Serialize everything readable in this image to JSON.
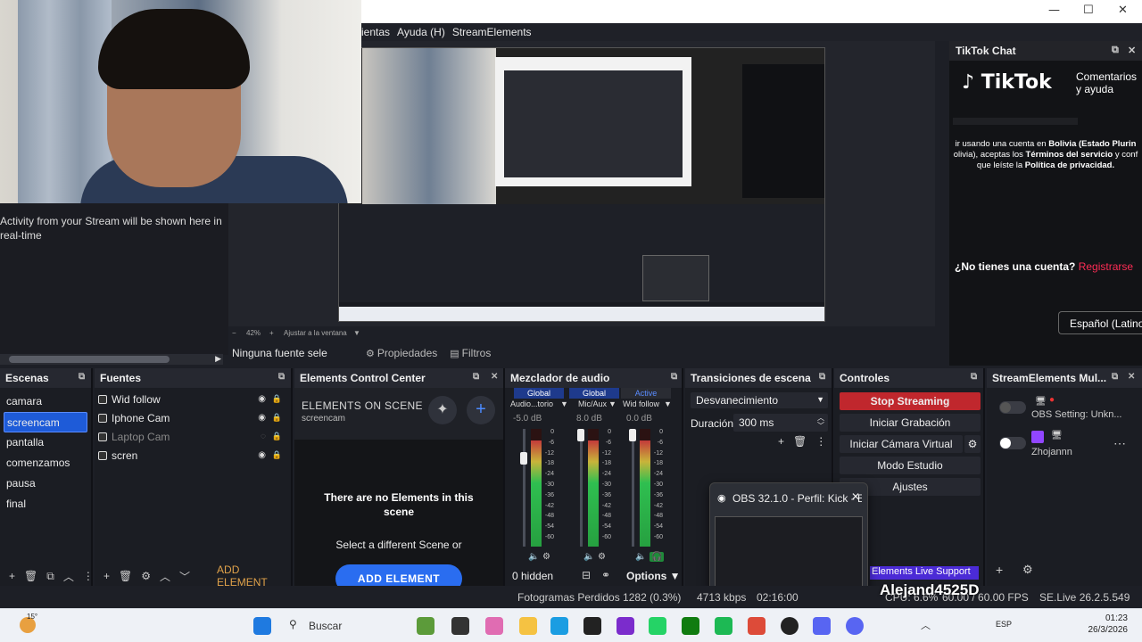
{
  "menu": {
    "items": [
      "ientas",
      "Ayuda (H)",
      "StreamElements"
    ]
  },
  "window_controls": {
    "minimize": "—",
    "maximize": "☐",
    "close": "✕"
  },
  "activity": {
    "text": "Activity from your Stream will be shown here in real-time"
  },
  "preview": {
    "zoom_label": "42%",
    "fit_label": "Ajustar a la ventana"
  },
  "tiktok_chat": {
    "title": "TikTok Chat",
    "logo_text": "TikTok",
    "subtitle_line1": "Comentarios",
    "subtitle_line2": "y ayuda",
    "terms_l1": "ir usando una cuenta en",
    "terms_l1b": "Bolivia (Estado Plurin",
    "terms_l2a": "olivia), aceptas los",
    "terms_l2b": "Términos del servicio",
    "terms_l2c": "y conf",
    "terms_l3a": "que leíste la",
    "terms_l3b": "Política de privacidad.",
    "question": "¿No tienes una cuenta?",
    "signup": "Registrarse",
    "language": "Español (Latino"
  },
  "source_toolbar": {
    "no_source": "Ninguna fuente sele",
    "properties": "Propiedades",
    "filters": "Filtros"
  },
  "scenes": {
    "title": "Escenas",
    "items": [
      "camara",
      "screencam",
      "pantalla",
      "comenzamos",
      "pausa",
      "final"
    ],
    "selected": "screencam"
  },
  "sources": {
    "title": "Fuentes",
    "items": [
      {
        "label": "Wid follow",
        "icon": "globe-icon",
        "visible": true
      },
      {
        "label": "Iphone Cam",
        "icon": "camera-icon",
        "visible": true
      },
      {
        "label": "Laptop Cam",
        "icon": "camera-icon",
        "visible": false
      },
      {
        "label": "scren",
        "icon": "monitor-icon",
        "visible": true
      }
    ],
    "add_element": "ADD ELEMENT"
  },
  "ecc": {
    "title": "Elements Control Center",
    "on_scene": "ELEMENTS ON SCENE",
    "scene_name": "screencam",
    "empty_l1": "There are no Elements in this",
    "empty_l2": "scene",
    "hint": "Select a different Scene or",
    "add_button": "ADD ELEMENT"
  },
  "mixer": {
    "title": "Mezclador de audio",
    "channels": [
      {
        "tag": "Global",
        "name": "Audio...torio",
        "db": "-5.0 dB",
        "level": 0.9
      },
      {
        "tag": "Global",
        "name": "Mic/Aux",
        "db": "8.0 dB",
        "level": 0.9
      },
      {
        "tag": "Active",
        "name": "Wid follow",
        "db": "0.0 dB",
        "level": 0.9
      }
    ],
    "scale": [
      "0",
      "-6",
      "-12",
      "-18",
      "-24",
      "-30",
      "-36",
      "-42",
      "-48",
      "-54",
      "-60"
    ],
    "hidden": "0 hidden",
    "options": "Options"
  },
  "transitions": {
    "title": "Transiciones de escena",
    "selected": "Desvanecimiento",
    "duration_label": "Duración",
    "duration_value": "300 ms"
  },
  "controls": {
    "title": "Controles",
    "buttons": [
      "Stop Streaming",
      "Iniciar Grabación",
      "Iniciar Cámara Virtual",
      "Modo Estudio",
      "Ajustes"
    ]
  },
  "se_multi": {
    "title": "StreamElements Mul...",
    "row1": "OBS Setting: Unkn...",
    "row2": "Zhojannn",
    "live_support": "Elements Live Support"
  },
  "popup": {
    "title": "OBS 32.1.0 - Perfil: Kick - E...",
    "close": "✕"
  },
  "status": {
    "dropped": "Fotogramas Perdidos 1282 (0.3%)",
    "bitrate": "4713 kbps",
    "time": "02:16:00",
    "cpu": "CPU: 6.6%",
    "fps": "60.00 / 60.00 FPS",
    "version": "SE.Live 26.2.5.549"
  },
  "overlay_user": "Alejand4525D",
  "taskbar": {
    "search": "Buscar",
    "lang": "ESP",
    "time": "01:23",
    "date": "26/3/2026",
    "weather": "15°"
  }
}
